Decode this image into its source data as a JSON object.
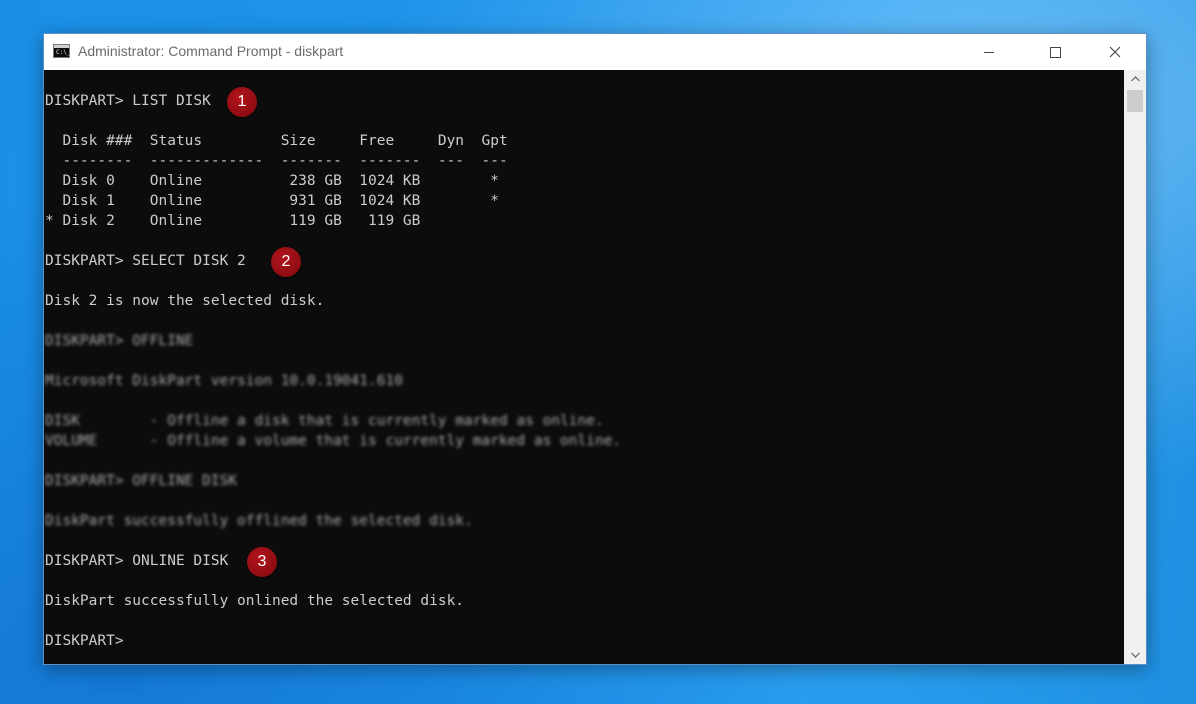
{
  "window": {
    "title": "Administrator: Command Prompt - diskpart",
    "icon": "cmd-icon",
    "icon_glyph": "C:\\_"
  },
  "console": {
    "lines": {
      "l01": "DISKPART> LIST DISK",
      "l02": "  Disk ###  Status         Size     Free     Dyn  Gpt",
      "l03": "  --------  -------------  -------  -------  ---  ---",
      "l04": "  Disk 0    Online          238 GB  1024 KB        *",
      "l05": "  Disk 1    Online          931 GB  1024 KB        *",
      "l06": "* Disk 2    Online          119 GB   119 GB",
      "l07": "DISKPART> SELECT DISK 2",
      "l08": "Disk 2 is now the selected disk.",
      "l09": "DISKPART> OFFLINE",
      "l10": "Microsoft DiskPart version 10.0.19041.610",
      "l11": "DISK        - Offline a disk that is currently marked as online.",
      "l12": "VOLUME      - Offline a volume that is currently marked as online.",
      "l13": "DISKPART> OFFLINE DISK",
      "l14": "DiskPart successfully offlined the selected disk.",
      "l15": "DISKPART> ONLINE DISK",
      "l16": "DiskPart successfully onlined the selected disk.",
      "l17": "DISKPART>"
    }
  },
  "badges": {
    "b1": "1",
    "b2": "2",
    "b3": "3"
  },
  "colors": {
    "console_bg": "#0c0c0c",
    "console_text": "#cccccc",
    "badge": "#9e1016",
    "desktop": "#1e94ea"
  }
}
